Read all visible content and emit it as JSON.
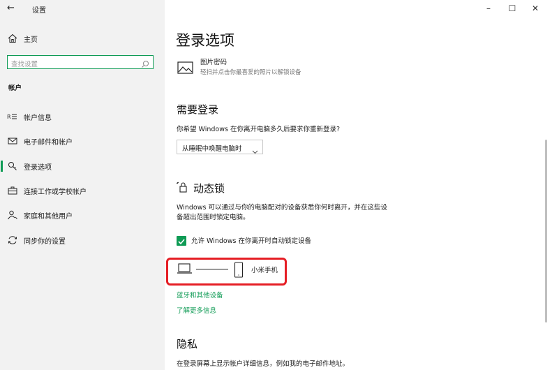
{
  "window": {
    "back_glyph": "←",
    "title": "设置",
    "minimize": "–",
    "maximize": "☐",
    "close": "✕"
  },
  "sidebar": {
    "home_label": "主页",
    "search_placeholder": "查找设置",
    "section_heading": "帐户",
    "items": [
      {
        "label": "帐户信息",
        "icon": "person-card-icon"
      },
      {
        "label": "电子邮件和帐户",
        "icon": "mail-icon"
      },
      {
        "label": "登录选项",
        "icon": "key-icon",
        "selected": true
      },
      {
        "label": "连接工作或学校帐户",
        "icon": "briefcase-icon"
      },
      {
        "label": "家庭和其他用户",
        "icon": "person-add-icon"
      },
      {
        "label": "同步你的设置",
        "icon": "sync-icon"
      }
    ]
  },
  "main": {
    "page_title": "登录选项",
    "picture_password": {
      "title": "图片密码",
      "desc": "轻扫并点击你最喜爱的照片以解锁设备"
    },
    "require_signin": {
      "heading": "需要登录",
      "question": "你希望 Windows 在你离开电脑多久后要求你重新登录?",
      "dropdown_value": "从睡眠中唤醒电脑时"
    },
    "dynamic_lock": {
      "heading": "动态锁",
      "desc_line1": "Windows 可以通过与你的电脑配对的设备获悉你何时离开，并在这些设",
      "desc_line2": "备超出范围时锁定电脑。",
      "checkbox_label": "允许 Windows 在你离开时自动锁定设备",
      "checkbox_checked": true,
      "paired_device": "小米手机",
      "link_bluetooth": "蓝牙和其他设备",
      "link_learn_more": "了解更多信息"
    },
    "privacy": {
      "heading": "隐私",
      "desc": "在登录屏幕上显示帐户详细信息，例如我的电子邮件地址。"
    }
  },
  "colors": {
    "accent": "#0f9b55",
    "highlight_box": "#e51e25",
    "sidebar_bg": "#f2f2f2"
  }
}
